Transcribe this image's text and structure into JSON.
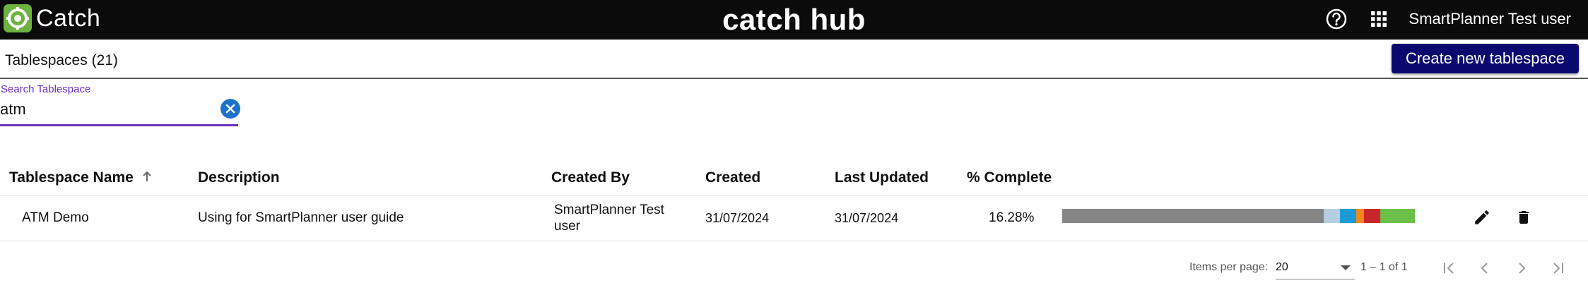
{
  "topbar": {
    "brand_name": "Catch",
    "hub_title": "catch hub",
    "user_name": "SmartPlanner Test user",
    "help_icon": "help-circle-icon",
    "apps_icon": "apps-grid-icon"
  },
  "header": {
    "title": "Tablespaces (21)",
    "create_button": "Create new tablespace"
  },
  "search": {
    "label": "Search Tablespace",
    "value": "atm",
    "clear_icon": "clear-circle-icon"
  },
  "table": {
    "columns": [
      "Tablespace Name",
      "Description",
      "Created By",
      "Created",
      "Last Updated",
      "% Complete"
    ],
    "sort_icon": "arrow-up-icon",
    "rows": [
      {
        "name": "ATM Demo",
        "description": "Using for SmartPlanner user guide",
        "created_by_line1": "SmartPlanner Test",
        "created_by_line2": "user",
        "created": "31/07/2024",
        "last_updated": "31/07/2024",
        "percent_complete": "16.28%",
        "progress_segments": [
          {
            "status": "not-started",
            "fraction": 0.741,
            "color": "#858585"
          },
          {
            "status": "planned",
            "fraction": 0.046,
            "color": "#b7cde3"
          },
          {
            "status": "in-progress",
            "fraction": 0.046,
            "color": "#1b9ad8"
          },
          {
            "status": "warning",
            "fraction": 0.023,
            "color": "#f0861e"
          },
          {
            "status": "blocked",
            "fraction": 0.046,
            "color": "#c8262c"
          },
          {
            "status": "complete",
            "fraction": 0.098,
            "color": "#6cc04a"
          }
        ],
        "edit_icon": "pencil-icon",
        "delete_icon": "trash-icon"
      }
    ]
  },
  "paginator": {
    "items_per_page_label": "Items per page:",
    "items_per_page_value": "20",
    "range_label": "1 – 1 of 1"
  },
  "colors": {
    "topbar_bg": "#0b0b0b",
    "primary_button": "#0b0970",
    "accent_purple": "#6c2fc1",
    "clear_blue": "#1a73c9",
    "brand_green": "#6cb33f"
  }
}
